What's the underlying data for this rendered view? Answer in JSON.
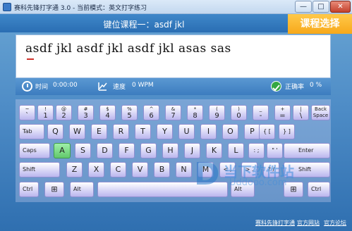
{
  "window": {
    "title": "赛科先锋打字通 3.0 - 当前模式：英文打字练习",
    "min": "—",
    "max": "□",
    "close": "✕"
  },
  "lesson": {
    "title": "键位课程一：asdf jkl",
    "select_button": "课程选择"
  },
  "practice": {
    "text": "asdf jkl asdf jkl asdf jkl asas sas"
  },
  "stats": {
    "time_label": "时间",
    "time_value": "0:00:00",
    "speed_label": "速度",
    "speed_value": "0 WPM",
    "accuracy_label": "正确率",
    "accuracy_value": "0 %"
  },
  "keyboard": {
    "row1": [
      {
        "top": "~",
        "main": "`"
      },
      {
        "top": "!",
        "main": "1"
      },
      {
        "top": "@",
        "main": "2"
      },
      {
        "top": "#",
        "main": "3"
      },
      {
        "top": "$",
        "main": "4"
      },
      {
        "top": "%",
        "main": "5"
      },
      {
        "top": "^",
        "main": "6"
      },
      {
        "top": "&",
        "main": "7"
      },
      {
        "top": "*",
        "main": "8"
      },
      {
        "top": "(",
        "main": "9"
      },
      {
        "top": ")",
        "main": "0"
      },
      {
        "top": "_",
        "main": "-"
      },
      {
        "top": "+",
        "main": "="
      },
      {
        "top": "|",
        "main": "\\"
      },
      {
        "top": "Back",
        "main": "Space"
      }
    ],
    "row2": [
      "Tab",
      "Q",
      "W",
      "E",
      "R",
      "T",
      "Y",
      "U",
      "I",
      "O",
      "P",
      "{ [",
      "} ]"
    ],
    "row3": [
      "Caps Lock",
      "A",
      "S",
      "D",
      "F",
      "G",
      "H",
      "J",
      "K",
      "L",
      ": ;",
      "\" '",
      "Enter"
    ],
    "row4": [
      "Shift",
      "Z",
      "X",
      "C",
      "V",
      "B",
      "N",
      "M",
      "< ,",
      "> .",
      "? /",
      "Shift"
    ],
    "row5": [
      "Ctrl",
      "⊞",
      "Alt",
      "Alt",
      "⊞",
      "Ctrl"
    ],
    "highlight_key": "A"
  },
  "watermark": {
    "letter": "D",
    "text": "当下软件站",
    "url": "Uddooo.com"
  },
  "footer": {
    "link1": "赛科先锋打字通",
    "link2": "官方网站",
    "link3": "官方论坛"
  },
  "colors": {
    "accent_orange": "#f7a81a",
    "header_blue": "#2a6eb3",
    "highlight_green": "#62c86c"
  }
}
